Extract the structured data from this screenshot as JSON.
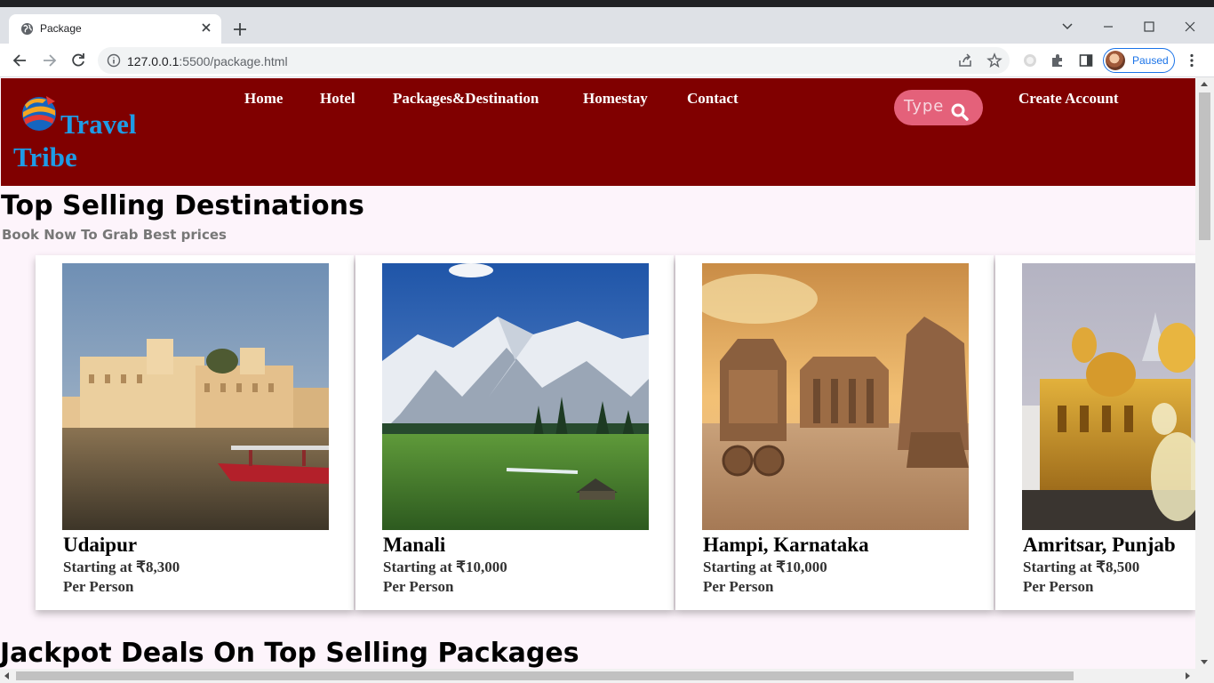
{
  "browser": {
    "tab_title": "Package",
    "url_host": "127.0.0.1",
    "url_rest": ":5500/package.html",
    "profile_status": "Paused"
  },
  "site": {
    "brand_line1": "Travel",
    "brand_line2": "Tribe",
    "nav": [
      "Home",
      "Hotel",
      "Packages&Destination",
      "Homestay",
      "Contact"
    ],
    "search_placeholder": "Type",
    "create_account": "Create Account",
    "colors": {
      "header_bg": "#800000",
      "brand": "#1e9be6",
      "search_bg": "#e4617a"
    }
  },
  "top_selling": {
    "title": "Top Selling Destinations",
    "subtitle": "Book Now To Grab Best prices",
    "cards": [
      {
        "name": "Udaipur",
        "price": "Starting at ₹8,300",
        "per": "Per Person",
        "image": "udaipur-palace-lake"
      },
      {
        "name": "Manali",
        "price": "Starting at ₹10,000",
        "per": "Per Person",
        "image": "snowy-mountains-meadow"
      },
      {
        "name": "Hampi, Karnataka",
        "price": "Starting at ₹10,000",
        "per": "Per Person",
        "image": "stone-chariot-temple"
      },
      {
        "name": "Amritsar, Punjab",
        "price": "Starting at ₹8,500",
        "per": "Per Person",
        "image": "golden-temple"
      }
    ]
  },
  "jackpot": {
    "title": "Jackpot Deals On Top Selling Packages"
  }
}
